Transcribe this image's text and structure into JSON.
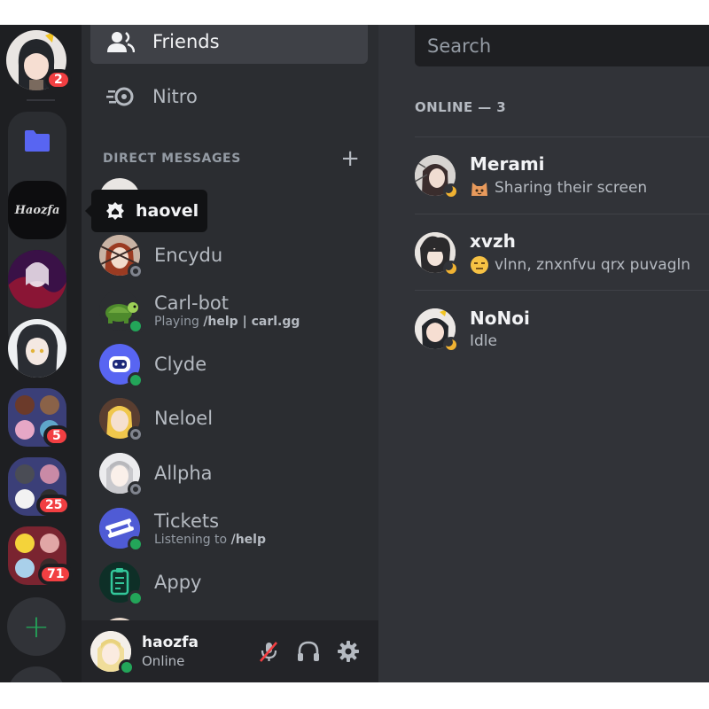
{
  "nav": {
    "friends": "Friends",
    "nitro": "Nitro"
  },
  "dm_header": {
    "title": "DIRECT MESSAGES",
    "add": "+"
  },
  "tooltip": {
    "label": "haovel"
  },
  "servers": {
    "home_badge": "2",
    "group1_badge": "5",
    "group2_badge": "25",
    "group3_badge": "71",
    "haovel_art": "Haozfa"
  },
  "dms": [
    {
      "name": "Encydu",
      "status": "offline"
    },
    {
      "name": "Carl-bot",
      "activity_prefix": "Playing",
      "activity": "/help | carl.gg",
      "status": "online"
    },
    {
      "name": "Clyde",
      "status": "online"
    },
    {
      "name": "Neloel",
      "status": "offline"
    },
    {
      "name": "Allpha",
      "status": "offline"
    },
    {
      "name": "Tickets",
      "activity_prefix": "Listening to",
      "activity": "/help",
      "status": "online"
    },
    {
      "name": "Appy",
      "status": "online"
    }
  ],
  "user": {
    "name": "haozfa",
    "status": "Online"
  },
  "search": {
    "placeholder": "Search"
  },
  "online_header": "ONLINE — 3",
  "friends": [
    {
      "name": "Merami",
      "activity": "Sharing their screen",
      "emoji": "cat-face"
    },
    {
      "name": "xvzh",
      "activity": "vlnn, znxnfvu qrx puvagln",
      "emoji": "unamused-face"
    },
    {
      "name": "NoNoi",
      "activity": "Idle"
    }
  ],
  "colors": {
    "accent": "#5865f2",
    "online": "#23a559",
    "idle": "#f0b232",
    "badge": "#f23f42"
  }
}
